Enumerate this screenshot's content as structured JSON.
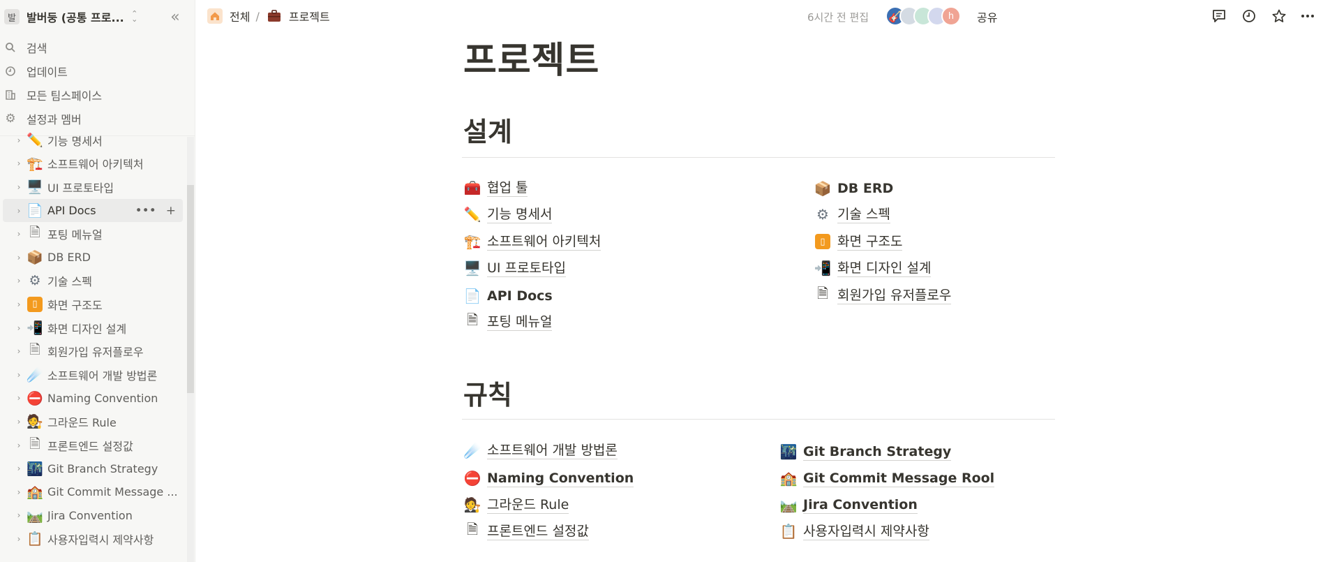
{
  "workspace": {
    "avatar": "발",
    "name": "발버둥 (공통 프로..."
  },
  "sidebar": {
    "nav": [
      {
        "label": "검색",
        "icon": "search-icon"
      },
      {
        "label": "업데이트",
        "icon": "clock-icon"
      },
      {
        "label": "모든 팀스페이스",
        "icon": "building-icon"
      },
      {
        "label": "설정과 멤버",
        "icon": "gear-icon"
      }
    ],
    "tree": [
      {
        "label": "기능 명세서",
        "icon": "pencil-icon"
      },
      {
        "label": "소프트웨어 아키텍처",
        "icon": "crane-icon"
      },
      {
        "label": "UI 프로토타입",
        "icon": "monitor-icon"
      },
      {
        "label": "API Docs",
        "icon": "document-icon"
      },
      {
        "label": "포팅 메뉴얼",
        "icon": "page-icon"
      },
      {
        "label": "DB ERD",
        "icon": "package-icon"
      },
      {
        "label": "기술 스펙",
        "icon": "gear-icon"
      },
      {
        "label": "화면 구조도",
        "icon": "vibration-icon"
      },
      {
        "label": "화면 디자인 설계",
        "icon": "phone-arrow-icon"
      },
      {
        "label": "회원가입 유저플로우",
        "icon": "page-icon"
      },
      {
        "label": "소프트웨어 개발 방법론",
        "icon": "comet-icon"
      },
      {
        "label": "Naming Convention",
        "icon": "no-entry-icon"
      },
      {
        "label": "그라운드 Rule",
        "icon": "judge-icon"
      },
      {
        "label": "프론트엔드 설정값",
        "icon": "page-icon"
      },
      {
        "label": "Git Branch Strategy",
        "icon": "night-city-icon"
      },
      {
        "label": "Git Commit Message ...",
        "icon": "school-icon"
      },
      {
        "label": "Jira Convention",
        "icon": "railway-icon"
      },
      {
        "label": "사용자입력시 제약사항",
        "icon": "clipboard-icon"
      }
    ]
  },
  "breadcrumb": {
    "home": "전체",
    "separator": "/",
    "current": "프로젝트"
  },
  "topbar": {
    "edited": "6시간 전 편집",
    "share": "공유",
    "avatar_letter": "h"
  },
  "page": {
    "title": "프로젝트",
    "sections": [
      {
        "heading": "설계",
        "left": [
          {
            "label": "협업 툴",
            "icon": "toolbox-icon",
            "bold": false
          },
          {
            "label": "기능 명세서",
            "icon": "pencil-icon",
            "bold": false
          },
          {
            "label": "소프트웨어 아키텍처",
            "icon": "crane-icon",
            "bold": false
          },
          {
            "label": "UI 프로토타입",
            "icon": "monitor-icon",
            "bold": false
          },
          {
            "label": "API Docs",
            "icon": "document-icon",
            "bold": true
          },
          {
            "label": "포팅 메뉴얼",
            "icon": "page-icon",
            "bold": false
          }
        ],
        "right": [
          {
            "label": "DB ERD",
            "icon": "package-icon",
            "bold": true
          },
          {
            "label": "기술 스펙",
            "icon": "gear-icon",
            "bold": false
          },
          {
            "label": "화면 구조도",
            "icon": "vibration-icon",
            "bold": false
          },
          {
            "label": "화면 디자인 설계",
            "icon": "phone-arrow-icon",
            "bold": false
          },
          {
            "label": "회원가입 유저플로우",
            "icon": "page-icon",
            "bold": false
          }
        ]
      },
      {
        "heading": "규칙",
        "left": [
          {
            "label": "소프트웨어 개발 방법론",
            "icon": "comet-icon",
            "bold": false
          },
          {
            "label": "Naming Convention",
            "icon": "no-entry-icon",
            "bold": true
          },
          {
            "label": "그라운드 Rule",
            "icon": "judge-icon",
            "bold": false
          },
          {
            "label": "프론트엔드 설정값",
            "icon": "page-icon",
            "bold": false
          }
        ],
        "right": [
          {
            "label": "Git Branch Strategy",
            "icon": "night-city-icon",
            "bold": true
          },
          {
            "label": "Git Commit Message Rool",
            "icon": "school-icon",
            "bold": true
          },
          {
            "label": "Jira Convention",
            "icon": "railway-icon",
            "bold": true
          },
          {
            "label": "사용자입력시 제약사항",
            "icon": "clipboard-icon",
            "bold": false
          }
        ]
      }
    ]
  },
  "colors": {
    "home_icon": "#f29a4b",
    "briefcase_icon": "#8b3a2b",
    "sidebar_bg": "#f7f7f5"
  }
}
